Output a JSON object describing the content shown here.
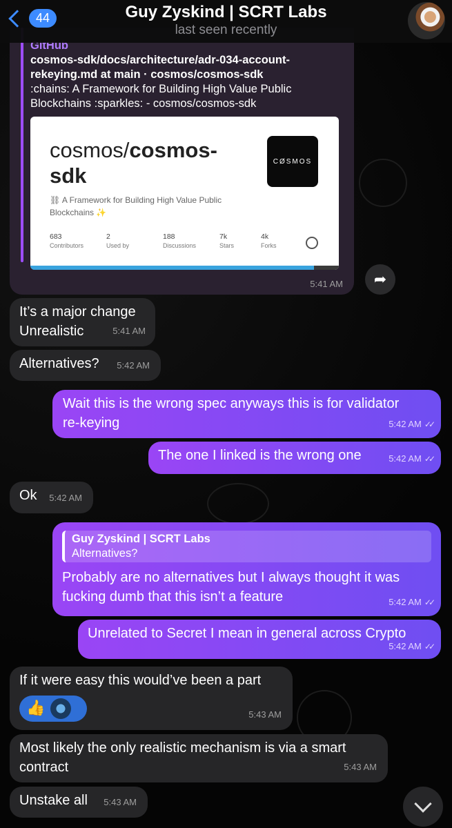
{
  "header": {
    "unread_count": "44",
    "title": "Guy Zyskind | SCRT Labs",
    "subtitle": "last seen recently"
  },
  "link_message": {
    "site": "GitHub",
    "page_title": "cosmos-sdk/docs/architecture/adr-034-account-rekeying.md at main · cosmos/cosmos-sdk",
    "description": ":chains: A Framework for Building High Value Public Blockchains :sparkles: - cosmos/cosmos-sdk",
    "preview_repo_owner": "cosmos/",
    "preview_repo_name_1": "cosmos-",
    "preview_repo_name_2": "sdk",
    "preview_desc": "⛓ A Framework for Building High Value Public Blockchains ✨",
    "logo_text": "CØSMOS",
    "stats": [
      {
        "value": "683",
        "label": "Contributors"
      },
      {
        "value": "2",
        "label": "Used by"
      },
      {
        "value": "188",
        "label": "Discussions"
      },
      {
        "value": "7k",
        "label": "Stars"
      },
      {
        "value": "4k",
        "label": "Forks"
      }
    ],
    "time": "5:41 AM"
  },
  "messages": [
    {
      "text_1": "It’s a major change",
      "text_2": "Unrealistic",
      "time": "5:41 AM"
    },
    {
      "text": "Alternatives?",
      "time": "5:42 AM"
    },
    {
      "text_1": "Wait this is the wrong spec anyways this is for validator",
      "text_2": "re-keying",
      "time": "5:42 AM"
    },
    {
      "text": "The one I linked is the wrong one",
      "time": "5:42 AM"
    },
    {
      "text": "Ok",
      "time": "5:42 AM"
    },
    {
      "quote_name": "Guy Zyskind | SCRT Labs",
      "quote_text": "Alternatives?",
      "text_1": "Probably are no alternatives but I always thought it was",
      "text_2": "fucking dumb that this isn’t a feature",
      "time": "5:42 AM"
    },
    {
      "text": "Unrelated to Secret I mean in general across Crypto",
      "time": "5:42 AM"
    },
    {
      "text": "If it were easy this would’ve been a part",
      "reaction": "👍",
      "time": "5:43 AM"
    },
    {
      "text_1": "Most likely the only realistic mechanism is via a smart",
      "text_2": "contract",
      "time": "5:43 AM"
    },
    {
      "text": "Unstake all",
      "time": "5:43 AM"
    }
  ],
  "colors": {
    "accent": "#3d8bff",
    "outgoing_start": "#9a45f5",
    "outgoing_end": "#6f4ef2",
    "incoming": "#262628"
  }
}
